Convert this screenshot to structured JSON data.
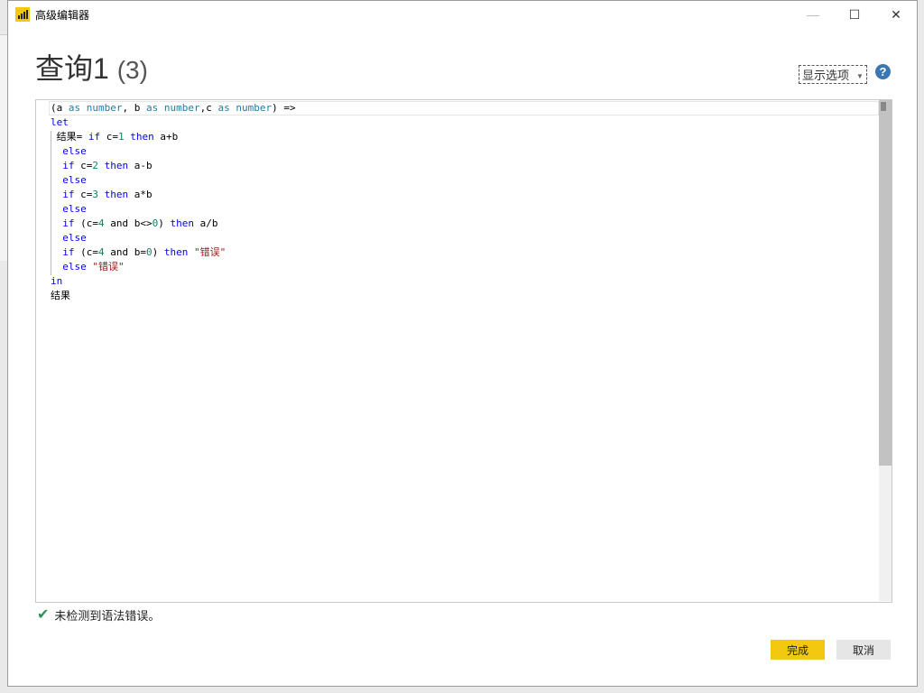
{
  "window": {
    "title": "高级编辑器",
    "minimize": "—",
    "maximize": "☐",
    "close": "✕"
  },
  "query": {
    "name": "查询1",
    "suffix": "(3)"
  },
  "display_options": "显示选项",
  "help": "?",
  "code": [
    [
      [
        "(a ",
        "txt"
      ],
      [
        "as",
        "typ"
      ],
      [
        " ",
        "txt"
      ],
      [
        "number",
        "typ"
      ],
      [
        ", b ",
        "txt"
      ],
      [
        "as",
        "typ"
      ],
      [
        " ",
        "txt"
      ],
      [
        "number",
        "typ"
      ],
      [
        ",c ",
        "txt"
      ],
      [
        "as",
        "typ"
      ],
      [
        " ",
        "txt"
      ],
      [
        "number",
        "typ"
      ],
      [
        ") =>",
        "txt"
      ]
    ],
    [
      [
        "let",
        "kw"
      ]
    ],
    [
      [
        " 结果= ",
        "txt"
      ],
      [
        "if",
        "kw"
      ],
      [
        " c=",
        "txt"
      ],
      [
        "1",
        "num"
      ],
      [
        " ",
        "txt"
      ],
      [
        "then",
        "kw"
      ],
      [
        " a+b",
        "txt"
      ]
    ],
    [
      [
        "  ",
        "txt"
      ],
      [
        "else",
        "kw"
      ]
    ],
    [
      [
        "  ",
        "txt"
      ],
      [
        "if",
        "kw"
      ],
      [
        " c=",
        "txt"
      ],
      [
        "2",
        "num"
      ],
      [
        " ",
        "txt"
      ],
      [
        "then",
        "kw"
      ],
      [
        " a-b",
        "txt"
      ]
    ],
    [
      [
        "  ",
        "txt"
      ],
      [
        "else",
        "kw"
      ]
    ],
    [
      [
        "  ",
        "txt"
      ],
      [
        "if",
        "kw"
      ],
      [
        " c=",
        "txt"
      ],
      [
        "3",
        "num"
      ],
      [
        " ",
        "txt"
      ],
      [
        "then",
        "kw"
      ],
      [
        " a*b",
        "txt"
      ]
    ],
    [
      [
        "  ",
        "txt"
      ],
      [
        "else",
        "kw"
      ]
    ],
    [
      [
        "  ",
        "txt"
      ],
      [
        "if",
        "kw"
      ],
      [
        " (c=",
        "txt"
      ],
      [
        "4",
        "num"
      ],
      [
        " and b<>",
        "txt"
      ],
      [
        "0",
        "num"
      ],
      [
        ") ",
        "txt"
      ],
      [
        "then",
        "kw"
      ],
      [
        " a/b",
        "txt"
      ]
    ],
    [
      [
        "  ",
        "txt"
      ],
      [
        "else",
        "kw"
      ]
    ],
    [
      [
        "  ",
        "txt"
      ],
      [
        "if",
        "kw"
      ],
      [
        " (c=",
        "txt"
      ],
      [
        "4",
        "num"
      ],
      [
        " and b=",
        "txt"
      ],
      [
        "0",
        "num"
      ],
      [
        ") ",
        "txt"
      ],
      [
        "then",
        "kw"
      ],
      [
        " ",
        "txt"
      ],
      [
        "\"错误\"",
        "str"
      ]
    ],
    [
      [
        "  ",
        "txt"
      ],
      [
        "else",
        "kw"
      ],
      [
        " ",
        "txt"
      ],
      [
        "\"错误\"",
        "str"
      ]
    ],
    [
      [
        "in",
        "kw"
      ]
    ],
    [
      [
        "结果",
        "txt"
      ]
    ]
  ],
  "status": {
    "icon": "✔",
    "text": "未检测到语法错误。"
  },
  "buttons": {
    "done": "完成",
    "cancel": "取消"
  }
}
